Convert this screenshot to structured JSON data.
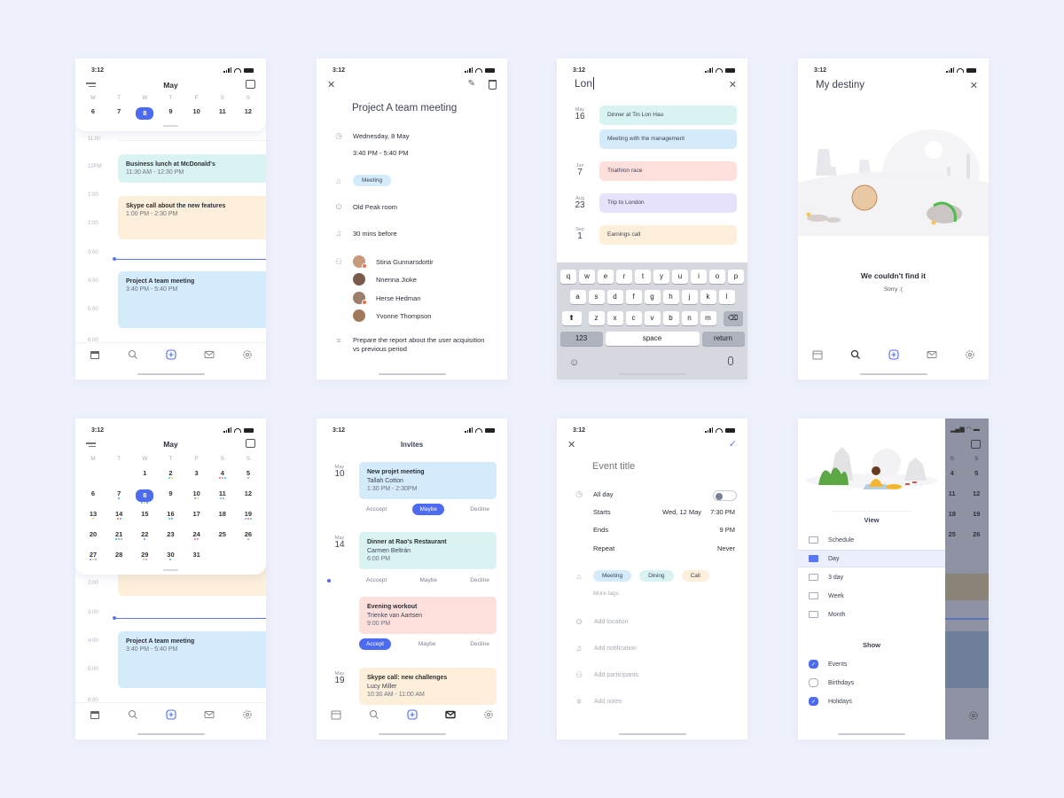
{
  "status_time": "3:12",
  "colors": {
    "accent": "#4d6bf0",
    "teal": "#d8f3f1",
    "blue": "#d4ebfb",
    "peach": "#fdefd9",
    "pink": "#fde0dc",
    "lavender": "#e7e2fb"
  },
  "tabbar": {
    "icons": [
      "calendar-icon",
      "search-icon",
      "add-icon",
      "mail-icon",
      "settings-icon"
    ]
  },
  "week_view": {
    "month": "May",
    "weekdays": [
      "M",
      "T",
      "W",
      "T",
      "F",
      "S",
      "S"
    ],
    "days": [
      "6",
      "7",
      "8",
      "9",
      "10",
      "11",
      "12"
    ],
    "selected": "8",
    "hours": [
      "11:00",
      "12PM",
      "1:00",
      "2:00",
      "3:00",
      "4:00",
      "5:00",
      "6:00"
    ],
    "events": [
      {
        "title": "Business lunch at McDonald's",
        "time": "11:30 AM - 12:30 PM"
      },
      {
        "title": "Skype call about the new features",
        "time": "1:00 PM - 2:30 PM"
      },
      {
        "title": "Project A team meeting",
        "time": "3:40 PM - 5:40 PM"
      }
    ]
  },
  "detail": {
    "title": "Project A team meeting",
    "date": "Wednesday, 8 May",
    "time": "3:40 PM - 5:40 PM",
    "tag": "Meeting",
    "location": "Old Peak room",
    "reminder": "30 mins before",
    "participants": [
      "Stina Gunnarsdottir",
      "Nnenna Jioke",
      "Herse Hedman",
      "Yvonne Thompson"
    ],
    "notes": "Prepare the report about the user acquisition vs previous period"
  },
  "search": {
    "query": "Lon",
    "results": [
      {
        "month": "May",
        "day": "16",
        "title": "Dinner at Tin Lon Hau"
      },
      {
        "month": "",
        "day": "",
        "title": "Meeting with the management"
      },
      {
        "month": "Jun",
        "day": "7",
        "title": "Triathlon race"
      },
      {
        "month": "Aug",
        "day": "23",
        "title": "Trip to London"
      },
      {
        "month": "Sep",
        "day": "1",
        "title": "Earnings call"
      }
    ],
    "keyboard": {
      "row1": [
        "q",
        "w",
        "e",
        "r",
        "t",
        "y",
        "u",
        "i",
        "o",
        "p"
      ],
      "row2": [
        "a",
        "s",
        "d",
        "f",
        "g",
        "h",
        "j",
        "k",
        "l"
      ],
      "row3": [
        "z",
        "x",
        "c",
        "v",
        "b",
        "n",
        "m"
      ],
      "num": "123",
      "space": "space",
      "return": "return"
    }
  },
  "empty": {
    "title": "My destiny",
    "heading": "We couldn't find it",
    "sub": "Sorry :("
  },
  "month_view": {
    "month": "May",
    "weekdays": [
      "M",
      "T",
      "W",
      "T",
      "F",
      "S",
      "S"
    ],
    "weeks": [
      [
        "",
        "",
        "1",
        "2",
        "3",
        "4",
        "5"
      ],
      [
        "6",
        "7",
        "8",
        "9",
        "10",
        "11",
        "12"
      ],
      [
        "13",
        "14",
        "15",
        "16",
        "17",
        "18",
        "19"
      ],
      [
        "20",
        "21",
        "22",
        "23",
        "24",
        "25",
        "26"
      ],
      [
        "27",
        "28",
        "29",
        "30",
        "31",
        "",
        ""
      ]
    ],
    "selected": "8",
    "hours": [
      "2:00",
      "3:00",
      "4:00",
      "5:00",
      "6:00"
    ],
    "event": {
      "title": "Project A team meeting",
      "time": "3:40 PM - 5:40 PM"
    }
  },
  "invites": {
    "title": "Invites",
    "items": [
      {
        "month": "May",
        "day": "10",
        "title": "New projet meeting",
        "person": "Tallah Cotton",
        "time": "1:30 PM - 2:30PM",
        "active": "Maybe"
      },
      {
        "month": "May",
        "day": "14",
        "title": "Dinner at Rao's Restaurant",
        "person": "Carmen Beltrán",
        "time": "6:00 PM",
        "active": ""
      },
      {
        "month": "",
        "day": "",
        "title": "Evening workout",
        "person": "Trienke van Aartsen",
        "time": "9:00 PM",
        "active": "Accept"
      },
      {
        "month": "May",
        "day": "19",
        "title": "Skype call: new challenges",
        "person": "Lucy Miller",
        "time": "10:30 AM - 11:00 AM",
        "active": ""
      }
    ],
    "accept_label_a": "Acccept",
    "accept_label_b": "Accept",
    "maybe_label": "Maybe",
    "decline_label": "Decline"
  },
  "new_event": {
    "title_placeholder": "Event title",
    "all_day_label": "All day",
    "all_day": false,
    "starts_label": "Starts",
    "starts_date": "Wed, 12 May",
    "starts_time": "7:30 PM",
    "ends_label": "Ends",
    "ends_time": "9 PM",
    "repeat_label": "Repeat",
    "repeat_value": "Never",
    "tags": [
      "Meeting",
      "Dining",
      "Call"
    ],
    "more_tags": "More tags",
    "add_location": "Add location",
    "add_notification": "Add notification",
    "add_participants": "Add participants",
    "add_notes": "Add notes"
  },
  "drawer": {
    "view_heading": "View",
    "views": [
      "Schedule",
      "Day",
      "3 day",
      "Week",
      "Month"
    ],
    "active_view": "Day",
    "show_heading": "Show",
    "filters": [
      {
        "label": "Events",
        "checked": true
      },
      {
        "label": "Birthdays",
        "checked": false
      },
      {
        "label": "Holidays",
        "checked": true
      }
    ],
    "behind": {
      "weekdays": [
        "S",
        "S"
      ],
      "rows": [
        [
          "4",
          "5"
        ],
        [
          "11",
          "12"
        ],
        [
          "18",
          "19"
        ],
        [
          "25",
          "26"
        ]
      ]
    }
  }
}
